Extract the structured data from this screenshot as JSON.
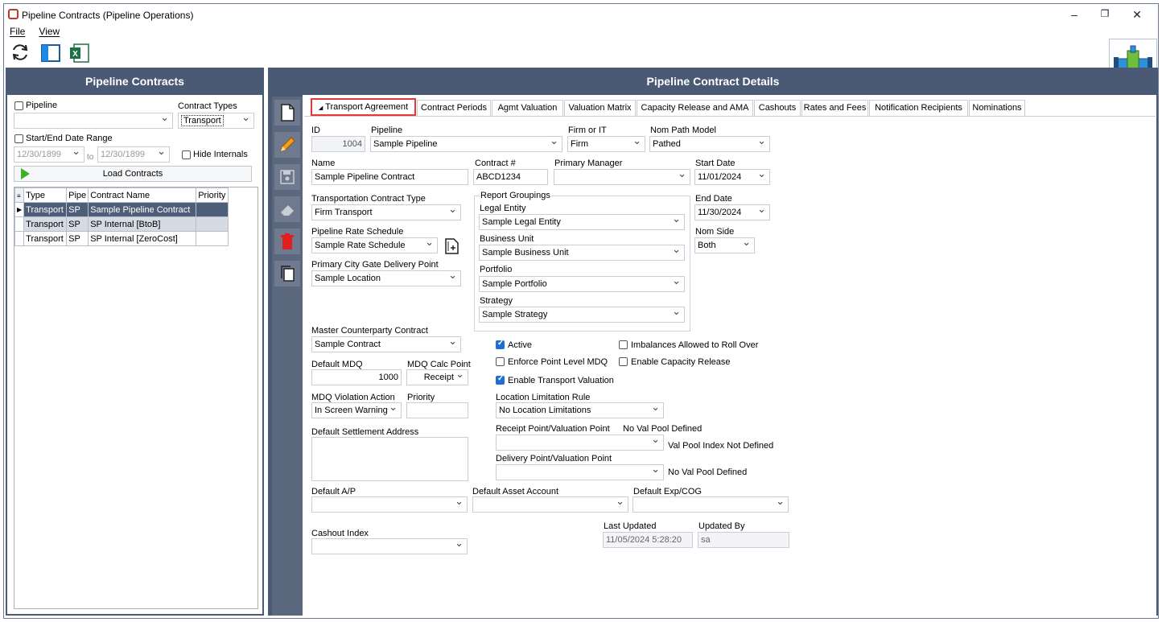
{
  "window": {
    "title": "Pipeline Contracts (Pipeline Operations)"
  },
  "menu": {
    "file": "File",
    "view": "View"
  },
  "left": {
    "header": "Pipeline Contracts",
    "pipeline_label": "Pipeline",
    "contract_types_label": "Contract Types",
    "contract_type_value": "Transport",
    "date_range_label": "Start/End Date Range",
    "start_date": "12/30/1899",
    "to_label": "to",
    "end_date": "12/30/1899",
    "hide_internals_label": "Hide Internals",
    "load_button": "Load Contracts",
    "grid": {
      "columns": [
        "Type",
        "Pipe",
        "Contract Name",
        "Priority"
      ],
      "rows": [
        [
          "Transport",
          "SP",
          "Sample Pipeline Contract",
          ""
        ],
        [
          "Transport",
          "SP",
          "SP Internal [BtoB]",
          ""
        ],
        [
          "Transport",
          "SP",
          "SP Internal [ZeroCost]",
          ""
        ]
      ]
    }
  },
  "right": {
    "header": "Pipeline Contract Details",
    "tabs": [
      "Transport Agreement",
      "Contract Periods",
      "Agmt Valuation",
      "Valuation Matrix",
      "Capacity Release and AMA",
      "Cashouts",
      "Rates and Fees",
      "Notification Recipients",
      "Nominations"
    ],
    "form": {
      "id_label": "ID",
      "id_value": "1004",
      "pipeline_label": "Pipeline",
      "pipeline_value": "Sample Pipeline",
      "firm_label": "Firm or IT",
      "firm_value": "Firm",
      "nom_path_label": "Nom Path Model",
      "nom_path_value": "Pathed",
      "name_label": "Name",
      "name_value": "Sample Pipeline Contract",
      "contract_no_label": "Contract #",
      "contract_no_value": "ABCD1234",
      "primary_manager_label": "Primary Manager",
      "primary_manager_value": "",
      "start_date_label": "Start Date",
      "start_date_value": "11/01/2024",
      "end_date_label": "End Date",
      "end_date_value": "11/30/2024",
      "nom_side_label": "Nom Side",
      "nom_side_value": "Both",
      "transport_type_label": "Transportation Contract Type",
      "transport_type_value": "Firm Transport",
      "report_groupings_label": "Report Groupings",
      "legal_entity_label": "Legal Entity",
      "legal_entity_value": "Sample Legal Entity",
      "business_unit_label": "Business Unit",
      "business_unit_value": "Sample Business Unit",
      "portfolio_label": "Portfolio",
      "portfolio_value": "Sample Portfolio",
      "strategy_label": "Strategy",
      "strategy_value": "Sample Strategy",
      "rate_schedule_label": "Pipeline Rate Schedule",
      "rate_schedule_value": "Sample Rate Schedule",
      "city_gate_label": "Primary City Gate Delivery Point",
      "city_gate_value": "Sample Location",
      "master_cp_label": "Master Counterparty Contract",
      "master_cp_value": "Sample Contract",
      "default_mdq_label": "Default MDQ",
      "default_mdq_value": "1000",
      "mdq_calc_label": "MDQ Calc Point",
      "mdq_calc_value": "Receipt",
      "mdq_violation_label": "MDQ Violation Action",
      "mdq_violation_value": "In Screen Warning",
      "priority_label": "Priority",
      "priority_value": "",
      "settlement_label": "Default Settlement Address",
      "active_label": "Active",
      "imbalances_label": "Imbalances Allowed to Roll Over",
      "enforce_label": "Enforce Point Level MDQ",
      "enable_capacity_label": "Enable Capacity Release",
      "enable_valuation_label": "Enable Transport Valuation",
      "location_rule_label": "Location Limitation Rule",
      "location_rule_value": "No Location Limitations",
      "receipt_point_label": "Receipt Point/Valuation Point",
      "no_val_pool_1": "No Val Pool Defined",
      "val_pool_index": "Val Pool Index Not Defined",
      "delivery_point_label": "Delivery Point/Valuation Point",
      "no_val_pool_2": "No Val Pool Defined",
      "default_ap_label": "Default A/P",
      "asset_account_label": "Default Asset Account",
      "exp_cog_label": "Default Exp/COG",
      "cashout_index_label": "Cashout Index",
      "last_updated_label": "Last Updated",
      "last_updated_value": "11/05/2024 5:28:20",
      "updated_by_label": "Updated By",
      "updated_by_value": "sa"
    }
  }
}
